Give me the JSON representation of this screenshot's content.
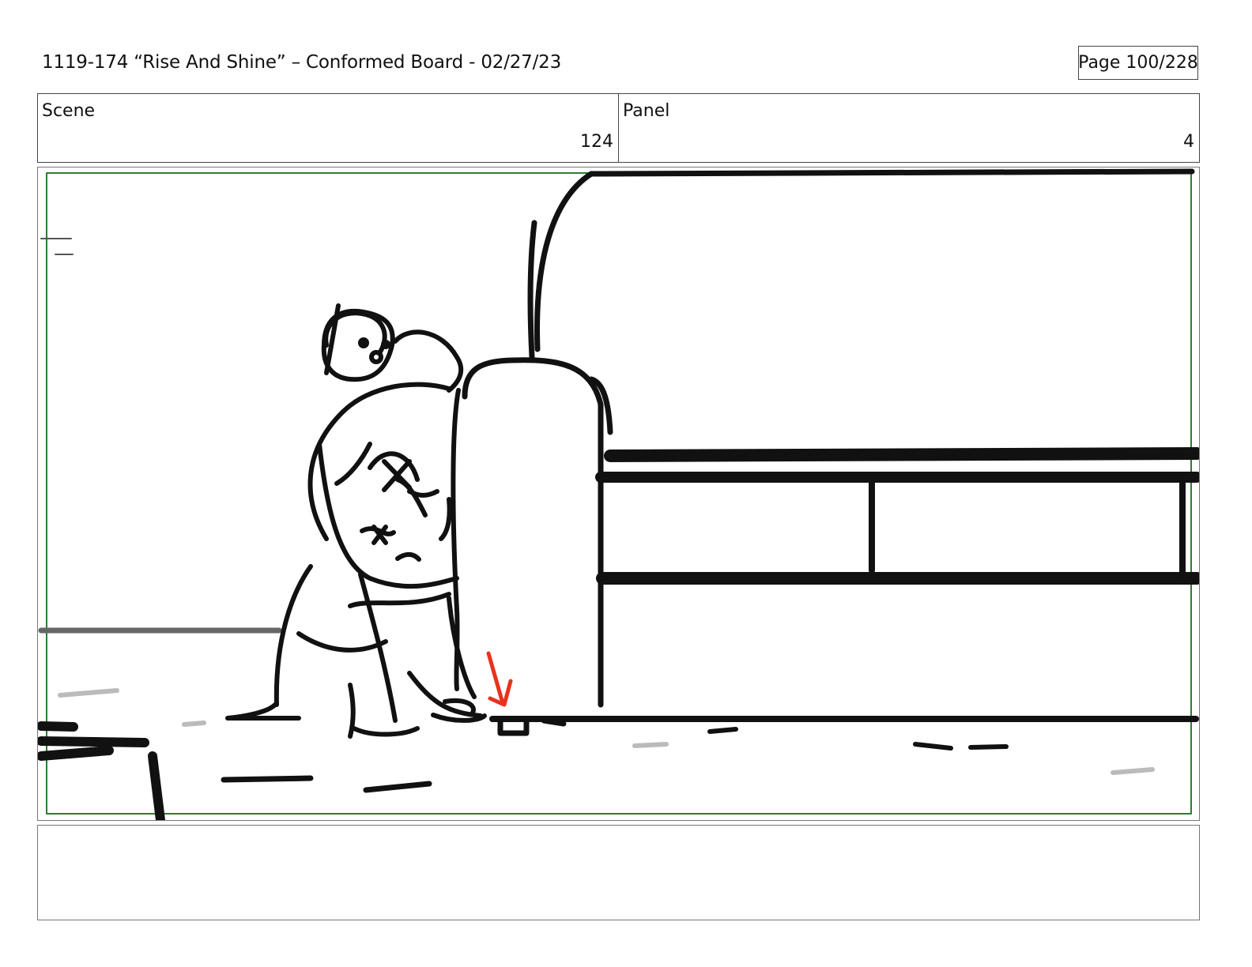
{
  "header": {
    "title": "1119-174 “Rise And Shine” – Conformed Board - 02/27/23",
    "page": "Page 100/228"
  },
  "scene": {
    "label": "Scene",
    "value": "124"
  },
  "panel": {
    "label": "Panel",
    "value": "4"
  },
  "colors": {
    "safe_frame": "#2e7d32",
    "ink": "#111111",
    "arrow": "#e8321e",
    "floor_marks": "#bbbbbb"
  }
}
